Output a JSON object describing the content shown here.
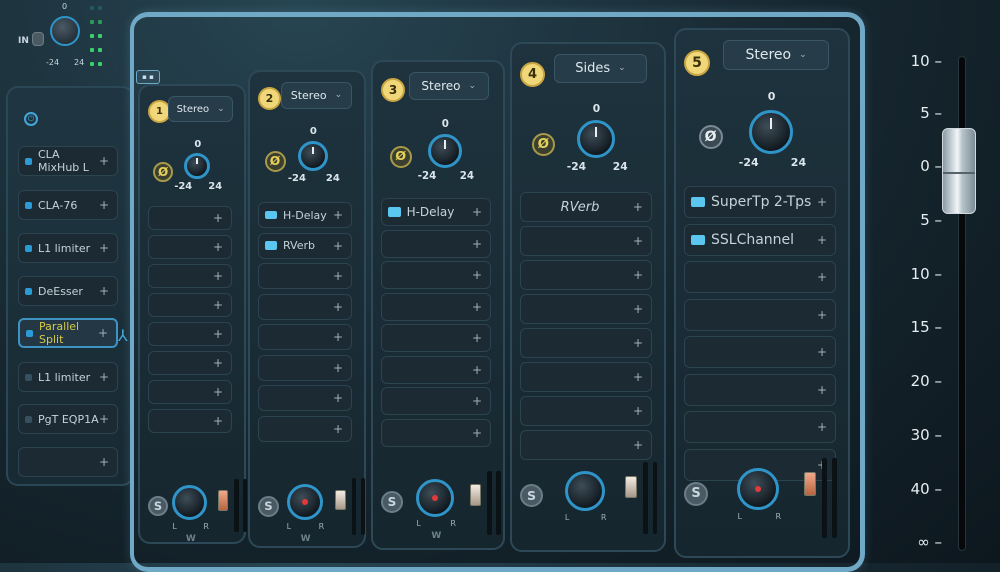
{
  "input": {
    "label": "IN",
    "knob_scale": {
      "top": "0",
      "min": "-24",
      "max": "24"
    }
  },
  "chain": {
    "items": [
      {
        "label": "CLA MixHub L",
        "active": false,
        "on": true
      },
      {
        "label": "CLA-76",
        "active": false,
        "on": true
      },
      {
        "label": "L1 limiter",
        "active": false,
        "on": true
      },
      {
        "label": "DeEsser",
        "active": false,
        "on": true
      },
      {
        "label": "Parallel Split",
        "active": true,
        "on": true
      },
      {
        "label": "L1 limiter",
        "active": false,
        "on": false
      },
      {
        "label": "PgT EQP1A",
        "active": false,
        "on": false
      },
      {
        "label": "",
        "active": false,
        "on": false
      }
    ],
    "plus": "+"
  },
  "frame_tab": "▪ ▪",
  "lanes": [
    {
      "number": "1",
      "mode": "Stereo",
      "knob_top": "0",
      "knob_min": "-24",
      "knob_max": "24",
      "phase": "Ø",
      "slots": [
        "",
        "",
        "",
        "",
        "",
        "",
        "",
        ""
      ],
      "solo": "S",
      "pan_l": "L",
      "pan_r": "R",
      "width": "W"
    },
    {
      "number": "2",
      "mode": "Stereo",
      "knob_top": "0",
      "knob_min": "-24",
      "knob_max": "24",
      "phase": "Ø",
      "slots": [
        "H-Delay",
        "RVerb",
        "",
        "",
        "",
        "",
        "",
        ""
      ],
      "solo": "S",
      "pan_l": "L",
      "pan_r": "R",
      "width": "W"
    },
    {
      "number": "3",
      "mode": "Stereo",
      "knob_top": "0",
      "knob_min": "-24",
      "knob_max": "24",
      "phase": "Ø",
      "slots": [
        "H-Delay",
        "",
        "",
        "",
        "",
        "",
        "",
        ""
      ],
      "solo": "S",
      "pan_l": "L",
      "pan_r": "R",
      "width": "W"
    },
    {
      "number": "4",
      "mode": "Sides",
      "knob_top": "0",
      "knob_min": "-24",
      "knob_max": "24",
      "phase": "Ø",
      "slots": [
        "RVerb",
        "",
        "",
        "",
        "",
        "",
        "",
        ""
      ],
      "solo": "S",
      "pan_l": "L",
      "pan_r": "R",
      "width": ""
    },
    {
      "number": "5",
      "mode": "Stereo",
      "knob_top": "0",
      "knob_min": "-24",
      "knob_max": "24",
      "phase": "Ø",
      "slots": [
        "SuperTp 2-Tps",
        "SSLChannel",
        "",
        "",
        "",
        "",
        "",
        ""
      ],
      "solo": "S",
      "pan_l": "L",
      "pan_r": "R",
      "width": ""
    }
  ],
  "output_scale": [
    "10 –",
    "5 –",
    "0 –",
    "5 –",
    "10 –",
    "15 –",
    "20 –",
    "30 –",
    "40 –",
    "∞ –"
  ],
  "colors": {
    "accent": "#2f94c8",
    "frame": "#6fa9c6",
    "badge": "#f0d87a",
    "active_text": "#d6c94a"
  }
}
